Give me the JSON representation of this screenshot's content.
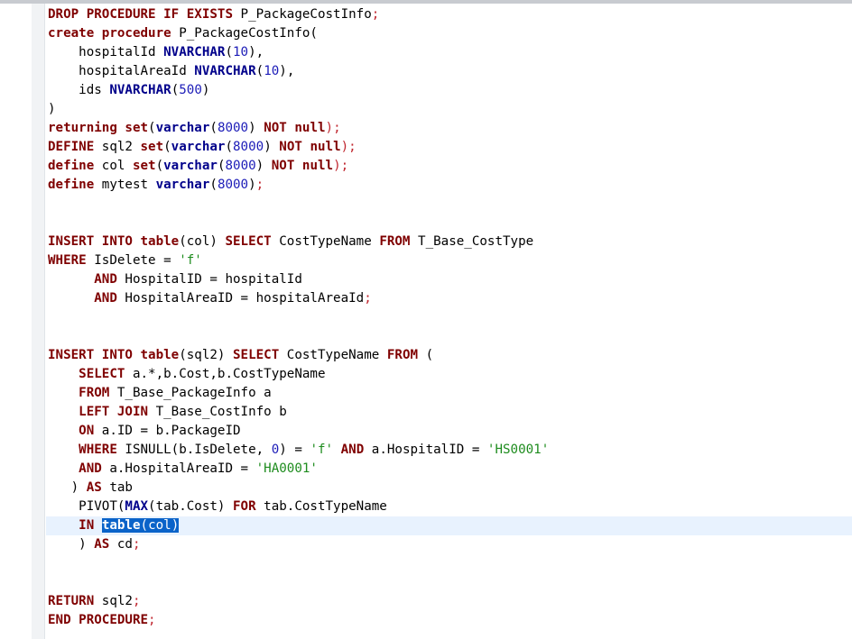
{
  "editor": {
    "lines": [
      [
        {
          "t": "DROP PROCEDURE IF EXISTS",
          "c": "kw"
        },
        {
          "t": " P_PackageCostInfo"
        },
        {
          "t": ";",
          "c": "pu"
        }
      ],
      [
        {
          "t": "create procedure",
          "c": "kw"
        },
        {
          "t": " P_PackageCostInfo("
        }
      ],
      [
        {
          "t": "    hospitalId "
        },
        {
          "t": "NVARCHAR",
          "c": "ty"
        },
        {
          "t": "("
        },
        {
          "t": "10",
          "c": "num"
        },
        {
          "t": "),"
        }
      ],
      [
        {
          "t": "    hospitalAreaId "
        },
        {
          "t": "NVARCHAR",
          "c": "ty"
        },
        {
          "t": "("
        },
        {
          "t": "10",
          "c": "num"
        },
        {
          "t": "),"
        }
      ],
      [
        {
          "t": "    ids "
        },
        {
          "t": "NVARCHAR",
          "c": "ty"
        },
        {
          "t": "("
        },
        {
          "t": "500",
          "c": "num"
        },
        {
          "t": ")"
        }
      ],
      [
        {
          "t": ")"
        }
      ],
      [
        {
          "t": "returning set",
          "c": "kw"
        },
        {
          "t": "("
        },
        {
          "t": "varchar",
          "c": "ty"
        },
        {
          "t": "("
        },
        {
          "t": "8000",
          "c": "num"
        },
        {
          "t": ") "
        },
        {
          "t": "NOT null",
          "c": "kw"
        },
        {
          "t": ");",
          "c": "pu"
        }
      ],
      [
        {
          "t": "DEFINE",
          "c": "kw"
        },
        {
          "t": " sql2 "
        },
        {
          "t": "set",
          "c": "kw"
        },
        {
          "t": "("
        },
        {
          "t": "varchar",
          "c": "ty"
        },
        {
          "t": "("
        },
        {
          "t": "8000",
          "c": "num"
        },
        {
          "t": ") "
        },
        {
          "t": "NOT null",
          "c": "kw"
        },
        {
          "t": ");",
          "c": "pu"
        }
      ],
      [
        {
          "t": "define",
          "c": "kw"
        },
        {
          "t": " col "
        },
        {
          "t": "set",
          "c": "kw"
        },
        {
          "t": "("
        },
        {
          "t": "varchar",
          "c": "ty"
        },
        {
          "t": "("
        },
        {
          "t": "8000",
          "c": "num"
        },
        {
          "t": ") "
        },
        {
          "t": "NOT null",
          "c": "kw"
        },
        {
          "t": ");",
          "c": "pu"
        }
      ],
      [
        {
          "t": "define",
          "c": "kw"
        },
        {
          "t": " mytest "
        },
        {
          "t": "varchar",
          "c": "ty"
        },
        {
          "t": "("
        },
        {
          "t": "8000",
          "c": "num"
        },
        {
          "t": ")"
        },
        {
          "t": ";",
          "c": "pu"
        }
      ],
      [],
      [],
      [
        {
          "t": "INSERT INTO table",
          "c": "kw"
        },
        {
          "t": "(col) "
        },
        {
          "t": "SELECT",
          "c": "kw"
        },
        {
          "t": " CostTypeName "
        },
        {
          "t": "FROM",
          "c": "kw"
        },
        {
          "t": " T_Base_CostType"
        }
      ],
      [
        {
          "t": "WHERE",
          "c": "kw"
        },
        {
          "t": " IsDelete = "
        },
        {
          "t": "'f'",
          "c": "str"
        }
      ],
      [
        {
          "t": "      "
        },
        {
          "t": "AND",
          "c": "kw"
        },
        {
          "t": " HospitalID = hospitalId"
        }
      ],
      [
        {
          "t": "      "
        },
        {
          "t": "AND",
          "c": "kw"
        },
        {
          "t": " HospitalAreaID = hospitalAreaId"
        },
        {
          "t": ";",
          "c": "pu"
        }
      ],
      [],
      [],
      [
        {
          "t": "INSERT INTO table",
          "c": "kw"
        },
        {
          "t": "(sql2) "
        },
        {
          "t": "SELECT",
          "c": "kw"
        },
        {
          "t": " CostTypeName "
        },
        {
          "t": "FROM",
          "c": "kw"
        },
        {
          "t": " ("
        }
      ],
      [
        {
          "t": "    "
        },
        {
          "t": "SELECT",
          "c": "kw"
        },
        {
          "t": " a.*,b.Cost,b.CostTypeName"
        }
      ],
      [
        {
          "t": "    "
        },
        {
          "t": "FROM",
          "c": "kw"
        },
        {
          "t": " T_Base_PackageInfo a"
        }
      ],
      [
        {
          "t": "    "
        },
        {
          "t": "LEFT JOIN",
          "c": "kw"
        },
        {
          "t": " T_Base_CostInfo b"
        }
      ],
      [
        {
          "t": "    "
        },
        {
          "t": "ON",
          "c": "kw"
        },
        {
          "t": " a.ID = b.PackageID"
        }
      ],
      [
        {
          "t": "    "
        },
        {
          "t": "WHERE",
          "c": "kw"
        },
        {
          "t": " ISNULL(b.IsDelete, "
        },
        {
          "t": "0",
          "c": "num"
        },
        {
          "t": ") = "
        },
        {
          "t": "'f'",
          "c": "str"
        },
        {
          "t": " "
        },
        {
          "t": "AND",
          "c": "kw"
        },
        {
          "t": " a.HospitalID = "
        },
        {
          "t": "'HS0001'",
          "c": "str"
        }
      ],
      [
        {
          "t": "    "
        },
        {
          "t": "AND",
          "c": "kw"
        },
        {
          "t": " a.HospitalAreaID = "
        },
        {
          "t": "'HA0001'",
          "c": "str"
        }
      ],
      [
        {
          "t": "   ) "
        },
        {
          "t": "AS",
          "c": "kw"
        },
        {
          "t": " tab"
        }
      ],
      [
        {
          "t": "    PIVOT("
        },
        {
          "t": "MAX",
          "c": "ty"
        },
        {
          "t": "(tab.Cost) "
        },
        {
          "t": "FOR",
          "c": "kw"
        },
        {
          "t": " tab.CostTypeName"
        }
      ],
      [
        {
          "t": "    "
        },
        {
          "t": "IN",
          "c": "kw"
        },
        {
          "t": " "
        },
        {
          "t": "table",
          "c": "ty",
          "sel": true
        },
        {
          "t": "(col)",
          "sel": true
        }
      ],
      [
        {
          "t": "    ) "
        },
        {
          "t": "AS",
          "c": "kw"
        },
        {
          "t": " cd"
        },
        {
          "t": ";",
          "c": "pu"
        }
      ],
      [],
      [],
      [
        {
          "t": "RETURN",
          "c": "kw"
        },
        {
          "t": " sql2"
        },
        {
          "t": ";",
          "c": "pu"
        }
      ],
      [
        {
          "t": "END PROCEDURE",
          "c": "kw"
        },
        {
          "t": ";",
          "c": "pu"
        }
      ]
    ]
  }
}
